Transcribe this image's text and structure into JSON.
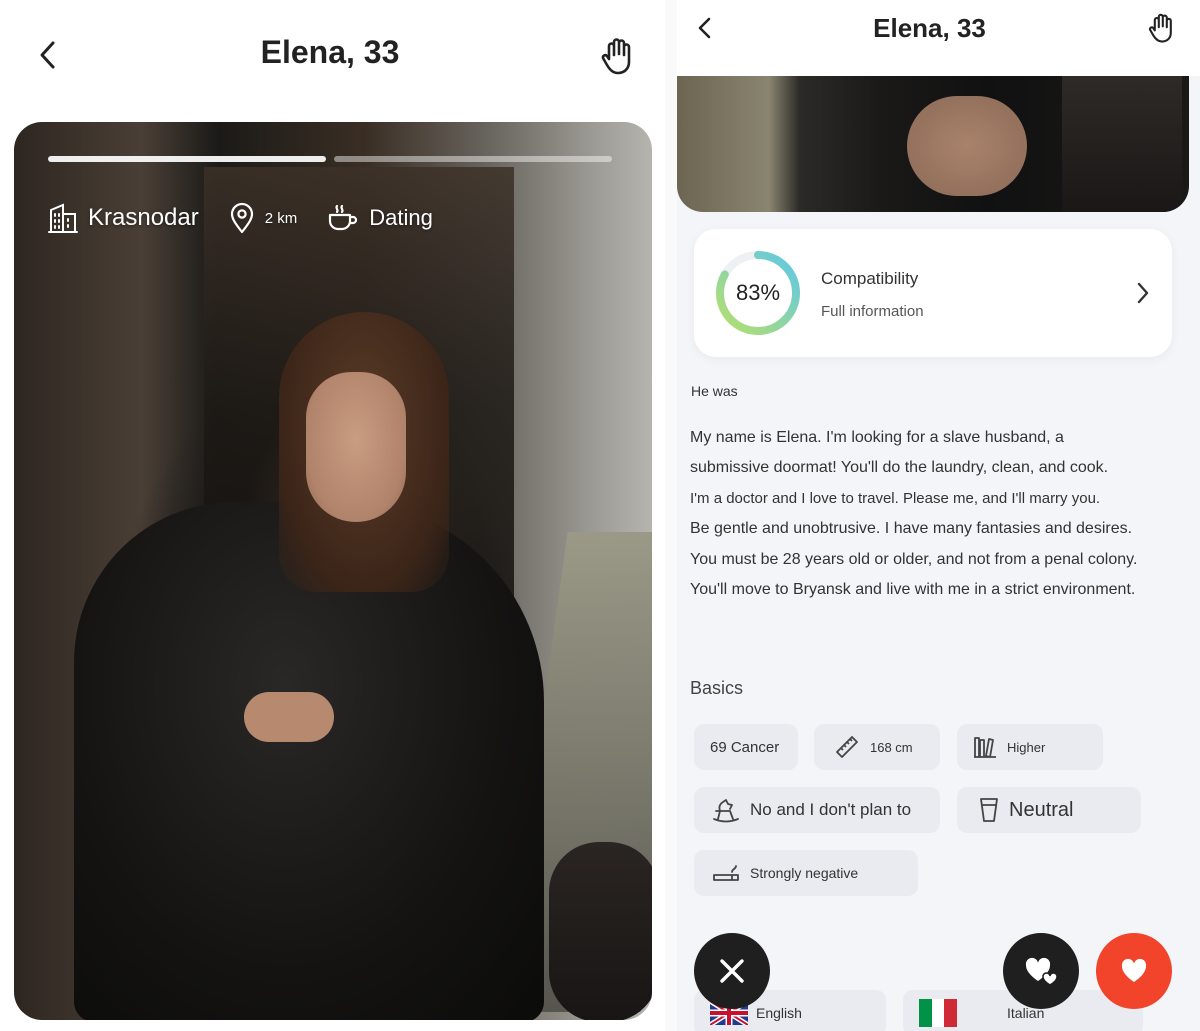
{
  "left_screen": {
    "header": {
      "title": "Elena, 33"
    },
    "photo": {
      "progress": {
        "total_segments": 2,
        "active_segment": 1
      }
    },
    "chips": {
      "city": "Krasnodar",
      "distance": "2 km",
      "goal": "Dating"
    }
  },
  "right_screen": {
    "header": {
      "title": "Elena, 33"
    },
    "compatibility": {
      "percent_label": "83%",
      "value": 0.83,
      "title": "Compatibility",
      "subtitle": "Full information"
    },
    "about": {
      "heading": "He was",
      "lines": [
        "My name is Elena. I'm looking for a slave husband, a",
        "submissive doormat! You'll do the laundry, clean, and cook.",
        "I'm a doctor and I love to travel. Please me, and I'll marry you.",
        "Be gentle and unobtrusive. I have many fantasies and desires.",
        "You must be 28 years old or older, and not from a penal colony.",
        "You'll move to Bryansk and live with me in a strict environment."
      ]
    },
    "basics": {
      "heading": "Basics",
      "tags": [
        {
          "label": "69 Cancer",
          "icon": "none"
        },
        {
          "label": "168 cm",
          "icon": "ruler-icon"
        },
        {
          "label": "Higher",
          "icon": "books-icon"
        },
        {
          "label": "No and I don't plan to",
          "icon": "rocking-horse-icon"
        },
        {
          "label": "Neutral",
          "icon": "glass-icon"
        },
        {
          "label": "Strongly negative",
          "icon": "cigarette-icon"
        }
      ]
    },
    "languages": [
      {
        "label": "English",
        "flag": "uk-flag-icon"
      },
      {
        "label": "Italian",
        "flag": "italy-flag-icon"
      }
    ],
    "actions": {
      "dislike_icon": "close-icon",
      "superlike_icon": "hearts-icon",
      "like_icon": "heart-icon"
    }
  },
  "colors": {
    "like_button": "#f2442a",
    "dark_button": "#1f1f1f",
    "ring_start": "#b7e06a",
    "ring_end": "#5ec8e8",
    "tag_bg": "#e9ebf1",
    "panel_bg": "#f4f5f8"
  }
}
